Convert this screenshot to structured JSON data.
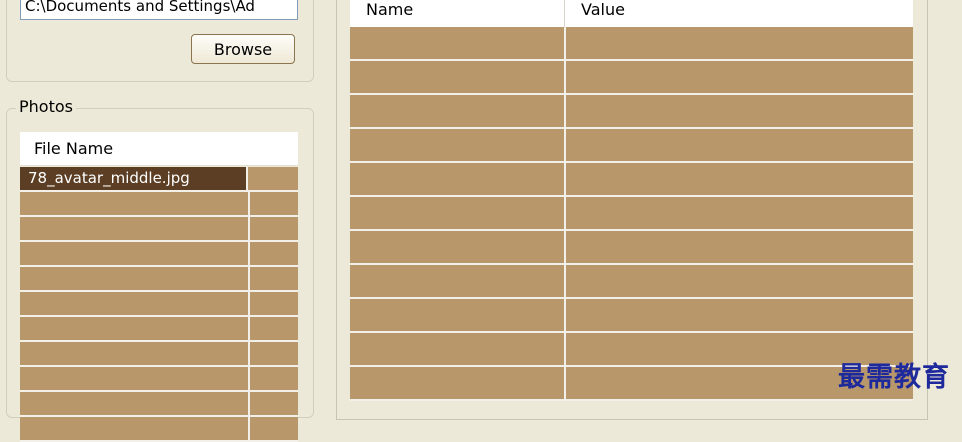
{
  "folder": {
    "path_value": "C:\\Documents and Settings\\Ad",
    "browse_label": "Browse"
  },
  "photos": {
    "group_label": "Photos",
    "column_header": "File Name",
    "files": [
      "78_avatar_middle.jpg"
    ],
    "empty_rows": 10
  },
  "properties": {
    "columns": [
      "Name",
      "Value"
    ],
    "empty_rows": 11
  },
  "watermark": "最需教育",
  "colors": {
    "row_fill": "#b8976a",
    "selected_fill": "#5b3e24"
  }
}
